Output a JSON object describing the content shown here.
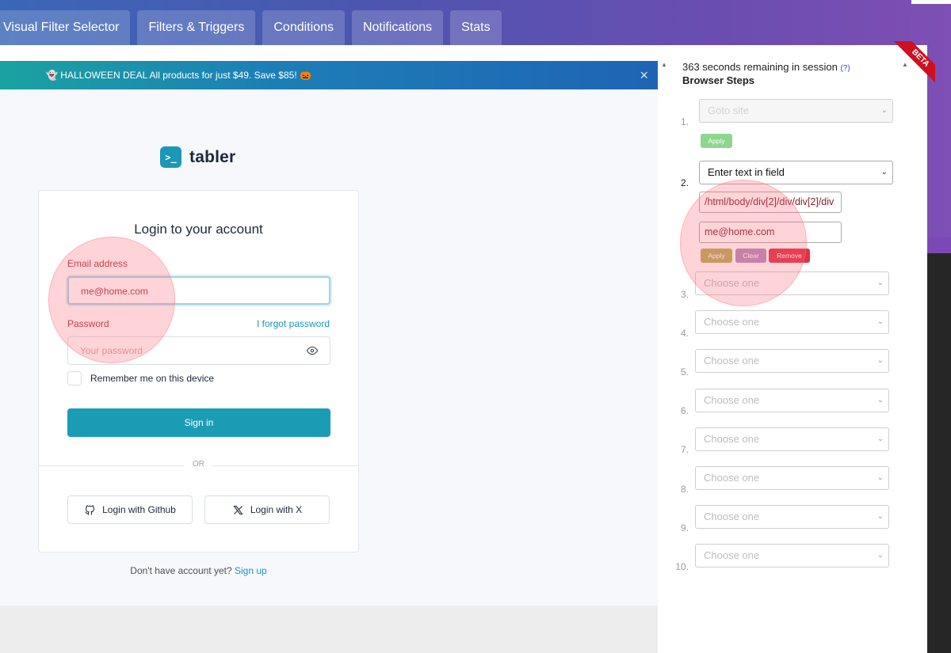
{
  "tabs": [
    {
      "label": "Visual Filter Selector"
    },
    {
      "label": "Filters & Triggers"
    },
    {
      "label": "Conditions"
    },
    {
      "label": "Notifications"
    },
    {
      "label": "Stats"
    }
  ],
  "browser": {
    "banner_text": "HALLOWEEN DEAL All products for just $49. Save $85!",
    "banner_emoji_left": "👻",
    "banner_emoji_right": "🎃",
    "banner_close": "×",
    "logo_mark": ">_",
    "logo_text": "tabler",
    "login": {
      "title": "Login to your account",
      "email_label": "Email address",
      "email_value": "me@home.com",
      "password_label": "Password",
      "forgot_link": "I forgot password",
      "password_placeholder": "Your password",
      "remember_label": "Remember me on this device",
      "signin_button": "Sign in",
      "divider": "OR",
      "github_button": "Login with Github",
      "x_button": "Login with X"
    },
    "signup_prompt": "Don't have account yet?",
    "signup_link": "Sign up"
  },
  "steps_panel": {
    "session_text": "363 seconds remaining in session",
    "session_help": "(?)",
    "title": "Browser Steps",
    "beta_label": "BETA",
    "steps": [
      {
        "num": "1.",
        "action": "Goto site"
      },
      {
        "num": "2.",
        "action": "Enter text in field",
        "selector": "/html/body/div[2]/div/div[2]/div",
        "value": "me@home.com"
      },
      {
        "num": "3.",
        "action": "Choose one"
      },
      {
        "num": "4.",
        "action": "Choose one"
      },
      {
        "num": "5.",
        "action": "Choose one"
      },
      {
        "num": "6.",
        "action": "Choose one"
      },
      {
        "num": "7.",
        "action": "Choose one"
      },
      {
        "num": "8.",
        "action": "Choose one"
      },
      {
        "num": "9.",
        "action": "Choose one"
      },
      {
        "num": "10.",
        "action": "Choose one"
      }
    ],
    "buttons": {
      "apply": "Apply",
      "clear": "Clear",
      "remove": "Remove"
    }
  },
  "colors": {
    "accent_teal": "#1b9cb5",
    "error_red": "#b8323a",
    "apply_green": "#8ed68e",
    "apply_olive": "#b4ae5a",
    "clear_purple": "#b28dbb",
    "remove_red": "#dd3344",
    "beta_red": "#cc1020"
  }
}
